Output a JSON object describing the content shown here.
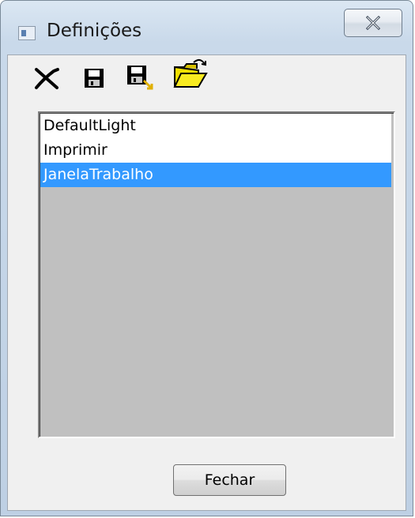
{
  "window": {
    "title": "Definições",
    "icon": "app-window-icon"
  },
  "titlebar": {
    "close_icon": "close-icon"
  },
  "toolbar": {
    "items": [
      {
        "icon": "delete-x-icon"
      },
      {
        "icon": "save-icon"
      },
      {
        "icon": "save-as-icon"
      },
      {
        "icon": "open-folder-icon"
      }
    ]
  },
  "list": {
    "items": [
      {
        "label": "DefaultLight",
        "selected": false
      },
      {
        "label": "Imprimir",
        "selected": false
      },
      {
        "label": "JanelaTrabalho",
        "selected": true
      }
    ],
    "selection_color": "#3399ff",
    "empty_color": "#c0c0c0"
  },
  "footer": {
    "close_label": "Fechar"
  }
}
